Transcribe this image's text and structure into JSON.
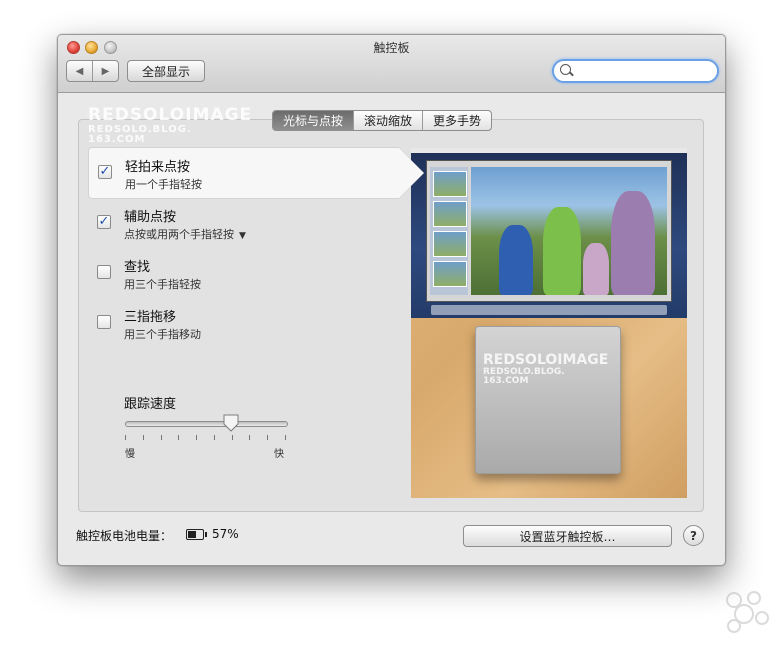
{
  "window": {
    "title": "触控板"
  },
  "toolbar": {
    "back_glyph": "◀",
    "forward_glyph": "▶",
    "show_all_label": "全部显示",
    "search_placeholder": ""
  },
  "tabs": [
    {
      "label": "光标与点按",
      "active": true
    },
    {
      "label": "滚动缩放",
      "active": false
    },
    {
      "label": "更多手势",
      "active": false
    }
  ],
  "watermark": {
    "line1": "REDSOLOIMAGE",
    "line2": "REDSOLO.BLOG.",
    "line3": "163.COM"
  },
  "options": [
    {
      "title": "轻拍来点按",
      "subtitle": "用一个手指轻按",
      "checked": true,
      "check_glyph": "✓"
    },
    {
      "title": "辅助点按",
      "subtitle": "点按或用两个手指轻按",
      "checked": true,
      "check_glyph": "✓",
      "caret": "▼"
    },
    {
      "title": "查找",
      "subtitle": "用三个手指轻按",
      "checked": false,
      "check_glyph": ""
    },
    {
      "title": "三指拖移",
      "subtitle": "用三个手指移动",
      "checked": false,
      "check_glyph": ""
    }
  ],
  "tracking_speed": {
    "label": "跟踪速度",
    "min_label": "慢",
    "max_label": "快",
    "value_fraction": 0.66,
    "tick_count": 10
  },
  "battery": {
    "label": "触控板电池电量：",
    "percent": "57%"
  },
  "bluetooth_button_label": "设置蓝牙触控板…",
  "help_label": "?",
  "colors": {
    "accent": "#6aa0e6",
    "check": "#1f4fa8",
    "tab_active": "#7a7a7a"
  },
  "icons": [
    "search-icon",
    "battery-icon",
    "help-icon",
    "checkbox-icon",
    "slider-knob-icon"
  ]
}
